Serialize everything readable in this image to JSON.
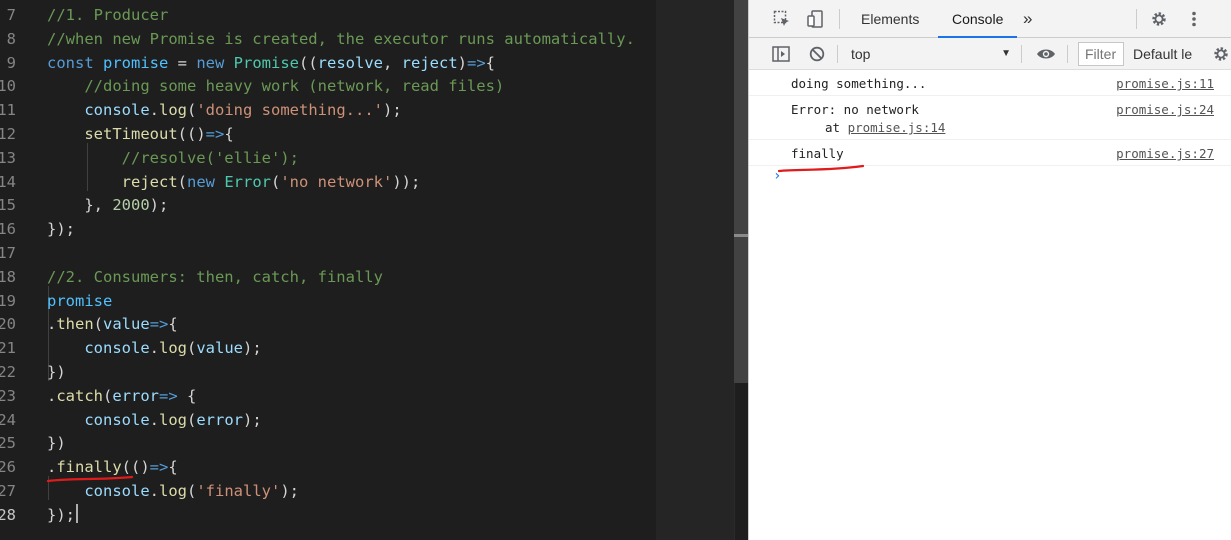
{
  "editor": {
    "lines": [
      {
        "n": "7",
        "tokens": [
          [
            "cm",
            "//1. Producer"
          ]
        ]
      },
      {
        "n": "8",
        "tokens": [
          [
            "cm",
            "//when new Promise is created, the executor runs automatically."
          ]
        ]
      },
      {
        "n": "9",
        "tokens": [
          [
            "kw",
            "const "
          ],
          [
            "vr",
            "promise"
          ],
          [
            "op",
            " = "
          ],
          [
            "kw",
            "new "
          ],
          [
            "cl",
            "Promise"
          ],
          [
            "op",
            "(("
          ],
          [
            "pm",
            "resolve"
          ],
          [
            "op",
            ", "
          ],
          [
            "pm",
            "reject"
          ],
          [
            "op",
            ")"
          ],
          [
            "kw",
            "=>"
          ],
          [
            "op",
            "{"
          ]
        ]
      },
      {
        "n": "10",
        "tokens": [
          [
            "op",
            "    "
          ],
          [
            "cm",
            "//doing some heavy work (network, read files)"
          ]
        ]
      },
      {
        "n": "11",
        "tokens": [
          [
            "op",
            "    "
          ],
          [
            "pm",
            "console"
          ],
          [
            "op",
            "."
          ],
          [
            "fn",
            "log"
          ],
          [
            "op",
            "("
          ],
          [
            "st",
            "'doing something...'"
          ],
          [
            "op",
            ");"
          ]
        ]
      },
      {
        "n": "12",
        "tokens": [
          [
            "op",
            "    "
          ],
          [
            "fn",
            "setTimeout"
          ],
          [
            "op",
            "(()"
          ],
          [
            "kw",
            "=>"
          ],
          [
            "op",
            "{"
          ]
        ]
      },
      {
        "n": "13",
        "tokens": [
          [
            "op",
            "        "
          ],
          [
            "cm",
            "//resolve('ellie');"
          ]
        ]
      },
      {
        "n": "14",
        "tokens": [
          [
            "op",
            "        "
          ],
          [
            "fn",
            "reject"
          ],
          [
            "op",
            "("
          ],
          [
            "kw",
            "new "
          ],
          [
            "cl",
            "Error"
          ],
          [
            "op",
            "("
          ],
          [
            "st",
            "'no network'"
          ],
          [
            "op",
            "));"
          ]
        ]
      },
      {
        "n": "15",
        "tokens": [
          [
            "op",
            "    }, "
          ],
          [
            "nu",
            "2000"
          ],
          [
            "op",
            ");"
          ]
        ]
      },
      {
        "n": "16",
        "tokens": [
          [
            "op",
            "});"
          ]
        ]
      },
      {
        "n": "17",
        "tokens": []
      },
      {
        "n": "18",
        "tokens": [
          [
            "cm",
            "//2. Consumers: then, catch, finally"
          ]
        ]
      },
      {
        "n": "19",
        "tokens": [
          [
            "vr",
            "promise"
          ]
        ]
      },
      {
        "n": "20",
        "tokens": [
          [
            "op",
            "."
          ],
          [
            "fn",
            "then"
          ],
          [
            "op",
            "("
          ],
          [
            "pm",
            "value"
          ],
          [
            "kw",
            "=>"
          ],
          [
            "op",
            "{"
          ]
        ]
      },
      {
        "n": "21",
        "tokens": [
          [
            "op",
            "    "
          ],
          [
            "pm",
            "console"
          ],
          [
            "op",
            "."
          ],
          [
            "fn",
            "log"
          ],
          [
            "op",
            "("
          ],
          [
            "pm",
            "value"
          ],
          [
            "op",
            ");"
          ]
        ]
      },
      {
        "n": "22",
        "tokens": [
          [
            "op",
            "})"
          ]
        ]
      },
      {
        "n": "23",
        "tokens": [
          [
            "op",
            "."
          ],
          [
            "fn",
            "catch"
          ],
          [
            "op",
            "("
          ],
          [
            "pm",
            "error"
          ],
          [
            "kw",
            "=> "
          ],
          [
            "op",
            "{"
          ]
        ]
      },
      {
        "n": "24",
        "tokens": [
          [
            "op",
            "    "
          ],
          [
            "pm",
            "console"
          ],
          [
            "op",
            "."
          ],
          [
            "fn",
            "log"
          ],
          [
            "op",
            "("
          ],
          [
            "pm",
            "error"
          ],
          [
            "op",
            ");"
          ]
        ]
      },
      {
        "n": "25",
        "tokens": [
          [
            "op",
            "})"
          ]
        ]
      },
      {
        "n": "26",
        "tokens": [
          [
            "op",
            "."
          ],
          [
            "fn",
            "finally"
          ],
          [
            "op",
            "(()"
          ],
          [
            "kw",
            "=>"
          ],
          [
            "op",
            "{"
          ]
        ]
      },
      {
        "n": "27",
        "tokens": [
          [
            "op",
            "    "
          ],
          [
            "pm",
            "console"
          ],
          [
            "op",
            "."
          ],
          [
            "fn",
            "log"
          ],
          [
            "op",
            "("
          ],
          [
            "st",
            "'finally'"
          ],
          [
            "op",
            ");"
          ]
        ]
      },
      {
        "n": "28",
        "tokens": [
          [
            "op",
            "});"
          ]
        ],
        "active": true
      }
    ]
  },
  "devtools": {
    "tabs": [
      "Elements",
      "Console"
    ],
    "active_tab": "Console",
    "more_tabs_glyph": "»",
    "context": "top",
    "filter_placeholder": "Filter",
    "levels_label": "Default le",
    "messages": [
      {
        "text": "doing something...",
        "source": "promise.js:11"
      },
      {
        "text": "Error: no network",
        "sub_prefix": "at ",
        "sub_link": "promise.js:14",
        "source": "promise.js:24"
      },
      {
        "text": "finally",
        "source": "promise.js:27"
      }
    ],
    "prompt": "›"
  },
  "colors": {
    "editor_bg": "#1e1e1e",
    "annotation": "#e01b1b",
    "devtools_accent": "#1a73e8"
  }
}
